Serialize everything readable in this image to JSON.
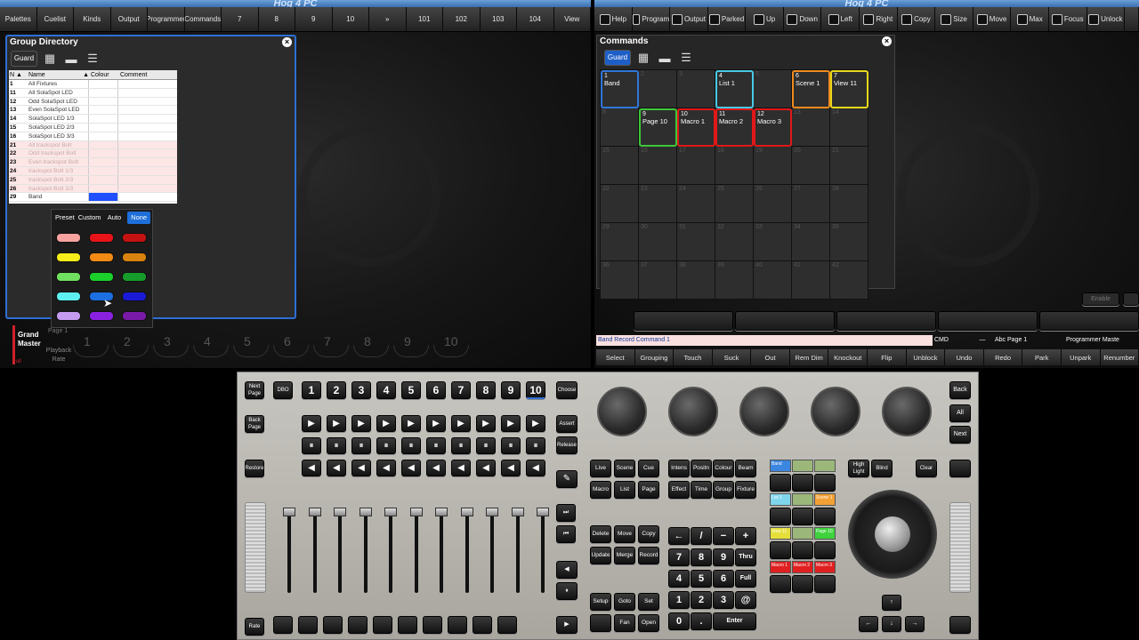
{
  "app": {
    "title_left": "Hog 4 PC",
    "title_right": "Hog 4 PC"
  },
  "left_toolbar": [
    "Palettes",
    "Cuelist",
    "Kinds",
    "Output",
    "Programmer",
    "Commands",
    "7",
    "8",
    "9",
    "10",
    "»",
    "101",
    "102",
    "103",
    "104",
    "View"
  ],
  "right_toolbar": [
    "Help",
    "Program",
    "Output",
    "Parked",
    "Up",
    "Down",
    "Left",
    "Right",
    "Copy",
    "Size",
    "Move",
    "Max",
    "Focus",
    "Unlock"
  ],
  "group_directory": {
    "title": "Group Directory",
    "guard": "Guard",
    "columns": [
      "N",
      "Name",
      "Colour",
      "Comment"
    ],
    "rows": [
      {
        "n": "1",
        "name": "All Fixtures",
        "dim": false
      },
      {
        "n": "11",
        "name": "All SolaSpot LED",
        "dim": false
      },
      {
        "n": "12",
        "name": "Odd SolaSpot LED",
        "dim": false
      },
      {
        "n": "13",
        "name": "Even SolaSpot LED",
        "dim": false
      },
      {
        "n": "14",
        "name": "SolaSpot LED 1/3",
        "dim": false
      },
      {
        "n": "15",
        "name": "SolaSpot LED 2/3",
        "dim": false
      },
      {
        "n": "16",
        "name": "SolaSpot LED 3/3",
        "dim": false
      },
      {
        "n": "21",
        "name": "All trackspot Bolt",
        "dim": true
      },
      {
        "n": "22",
        "name": "Odd trackspot Bolt",
        "dim": true
      },
      {
        "n": "23",
        "name": "Even trackspot Bolt",
        "dim": true
      },
      {
        "n": "24",
        "name": "trackspot Bolt 1/3",
        "dim": true
      },
      {
        "n": "25",
        "name": "trackspot Bolt 2/3",
        "dim": true
      },
      {
        "n": "26",
        "name": "trackspot Bolt 3/3",
        "dim": true
      },
      {
        "n": "29",
        "name": "Band",
        "dim": false
      }
    ]
  },
  "color_picker": {
    "tabs": [
      "Preset",
      "Custom",
      "Auto",
      "None"
    ],
    "selected_tab": "None",
    "swatches": [
      "#f6a3a0",
      "#e8141a",
      "#c41212",
      "#f5ec1a",
      "#f28a14",
      "#d9820f",
      "#6fe05f",
      "#1bd02b",
      "#169c2a",
      "#5ef0f0",
      "#1b6fe0",
      "#1a1ad6",
      "#c59bef",
      "#8a20e0",
      "#7a1aa8"
    ]
  },
  "commands": {
    "title": "Commands",
    "guard": "Guard",
    "cells": [
      {
        "n": "1",
        "label": "Band",
        "color": "#2f76d8"
      },
      {
        "n": "2"
      },
      {
        "n": "3"
      },
      {
        "n": "4",
        "label": "List 1",
        "color": "#48c9e8"
      },
      {
        "n": "5"
      },
      {
        "n": "6",
        "label": "Scene 1",
        "color": "#f08a1c"
      },
      {
        "n": "7",
        "label": "View 11",
        "color": "#e8d81c"
      },
      {
        "n": "8"
      },
      {
        "n": "9",
        "label": "Page 10",
        "color": "#3cc83a"
      },
      {
        "n": "10",
        "label": "Macro 1",
        "color": "#e01818"
      },
      {
        "n": "11",
        "label": "Macro 2",
        "color": "#e01818"
      },
      {
        "n": "12",
        "label": "Macro 3",
        "color": "#e01818"
      },
      {
        "n": "13"
      },
      {
        "n": "14"
      },
      {
        "n": "15"
      },
      {
        "n": "16"
      },
      {
        "n": "17"
      },
      {
        "n": "18"
      },
      {
        "n": "19"
      },
      {
        "n": "20"
      },
      {
        "n": "21"
      },
      {
        "n": "22"
      },
      {
        "n": "23"
      },
      {
        "n": "24"
      },
      {
        "n": "25"
      },
      {
        "n": "26"
      },
      {
        "n": "27"
      },
      {
        "n": "28"
      },
      {
        "n": "29"
      },
      {
        "n": "30"
      },
      {
        "n": "31"
      },
      {
        "n": "32"
      },
      {
        "n": "33"
      },
      {
        "n": "34"
      },
      {
        "n": "35"
      },
      {
        "n": "36"
      },
      {
        "n": "37"
      },
      {
        "n": "38"
      },
      {
        "n": "39"
      },
      {
        "n": "40"
      },
      {
        "n": "41"
      },
      {
        "n": "42"
      }
    ],
    "enable": "Enable"
  },
  "playback": {
    "grand": "Grand Master",
    "page": "Page 1",
    "rate": "Playback Rate",
    "full": "Full",
    "faders": [
      "1",
      "2",
      "3",
      "4",
      "5",
      "6",
      "7",
      "8",
      "9",
      "10"
    ]
  },
  "command_line": {
    "text": "Band Record Command 1",
    "cmd": "CMD",
    "dash": "—",
    "page": "Abc Page 1",
    "prog": "Programmer Maste"
  },
  "bottom_keys": [
    "Select",
    "Grouping",
    "Touch",
    "Suck",
    "Out",
    "Rem Dim",
    "Knockout",
    "Flip",
    "Unblock",
    "Undo",
    "Redo",
    "Park",
    "Unpark",
    "Renumber"
  ],
  "desk": {
    "next_page": "Next Page",
    "dbo": "DBO",
    "back_page": "Back Page",
    "restore": "Restore",
    "rate": "Rate",
    "choose": "Choose",
    "assert": "Assert",
    "release": "Release",
    "master_nums": [
      "1",
      "2",
      "3",
      "4",
      "5",
      "6",
      "7",
      "8",
      "9",
      "10"
    ],
    "back": "Back",
    "all": "All",
    "next": "Next",
    "view_keys": [
      "Live",
      "Scene",
      "Cue",
      "Macro",
      "List",
      "Page"
    ],
    "kind_keys": [
      "Intens",
      "Positn",
      "Colour",
      "Beam",
      "Effect",
      "Time",
      "Group",
      "Fixture"
    ],
    "edit_keys": [
      "Delete",
      "Move",
      "Copy",
      "Update",
      "Merge",
      "Record"
    ],
    "setup_keys": [
      "Setup",
      "Goto",
      "Set",
      "",
      "Fan",
      "Open"
    ],
    "keypad": [
      "←",
      "/",
      "−",
      "+",
      "7",
      "8",
      "9",
      "Thru",
      "4",
      "5",
      "6",
      "Full",
      "1",
      "2",
      "3",
      "@",
      "0",
      ".",
      "Enter"
    ],
    "hilight": "High Light",
    "blind": "Blind",
    "clear": "Clear",
    "mini": [
      {
        "t": "Band",
        "c": "#3b86e0"
      },
      {
        "t": "",
        "c": "#9bb87a"
      },
      {
        "t": "",
        "c": "#9bb87a"
      },
      {
        "t": "List 1",
        "c": "#7fd6ec"
      },
      {
        "t": "",
        "c": "#9bb87a"
      },
      {
        "t": "Scene 1",
        "c": "#f2a033"
      },
      {
        "t": "View 11",
        "c": "#e6df3a"
      },
      {
        "t": "",
        "c": "#9bb87a"
      },
      {
        "t": "Page 10",
        "c": "#3ed23c"
      },
      {
        "t": "Macro 1",
        "c": "#e02020"
      },
      {
        "t": "Macro 2",
        "c": "#e02020"
      },
      {
        "t": "Macro 3",
        "c": "#e02020"
      }
    ]
  }
}
